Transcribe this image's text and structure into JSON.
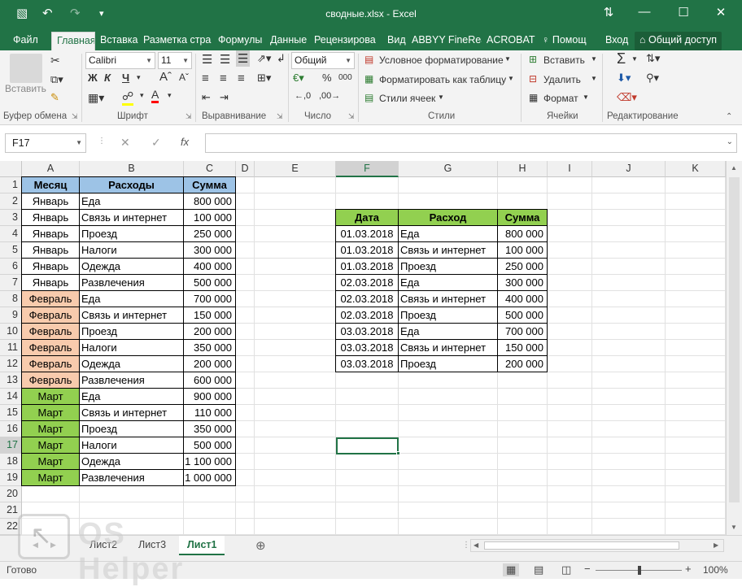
{
  "window": {
    "title": "сводные.xlsx - Excel",
    "controls": [
      "↑↓",
      "—",
      "☐",
      "✕"
    ]
  },
  "qat": [
    "💾",
    "↶",
    "↷",
    "▾"
  ],
  "tabs": [
    "Файл",
    "Главная",
    "Вставка",
    "Разметка стра",
    "Формулы",
    "Данные",
    "Рецензирова",
    "Вид",
    "ABBYY FineRea",
    "ACROBAT",
    "♀ Помощ",
    "Вход",
    "⌂ Общий доступ"
  ],
  "ribbon": {
    "clipboard": {
      "paste": "Вставить",
      "label": "Буфер обмена"
    },
    "font": {
      "name": "Calibri",
      "size": "11",
      "label": "Шрифт",
      "bold": "Ж",
      "italic": "К",
      "underline": "Ч"
    },
    "align": {
      "label": "Выравнивание"
    },
    "number": {
      "format": "Общий",
      "label": "Число",
      "percent": "%",
      "thousands": "000"
    },
    "styles": {
      "conditional": "Условное форматирование",
      "astable": "Форматировать как таблицу",
      "cellstyles": "Стили ячеек",
      "label": "Стили"
    },
    "cells": {
      "insert": "Вставить",
      "delete": "Удалить",
      "format": "Формат",
      "label": "Ячейки"
    },
    "editing": {
      "label": "Редактирование",
      "sum": "Σ"
    }
  },
  "formula": {
    "namebox": "F17",
    "fx": "fx",
    "cancel": "✕",
    "enter": "✓",
    "content": ""
  },
  "columns": [
    "A",
    "B",
    "C",
    "D",
    "E",
    "F",
    "G",
    "H",
    "I",
    "J",
    "K"
  ],
  "rows": [
    "1",
    "2",
    "3",
    "4",
    "5",
    "6",
    "7",
    "8",
    "9",
    "10",
    "11",
    "12",
    "13",
    "14",
    "15",
    "16",
    "17",
    "18",
    "19",
    "20",
    "21",
    "22"
  ],
  "table1": {
    "headers": [
      "Месяц",
      "Расходы",
      "Сумма"
    ],
    "rows": [
      [
        "Январь",
        "Еда",
        "800 000"
      ],
      [
        "Январь",
        "Связь и интернет",
        "100 000"
      ],
      [
        "Январь",
        "Проезд",
        "250 000"
      ],
      [
        "Январь",
        "Налоги",
        "300 000"
      ],
      [
        "Январь",
        "Одежда",
        "400 000"
      ],
      [
        "Январь",
        "Развлечения",
        "500 000"
      ],
      [
        "Февраль",
        "Еда",
        "700 000"
      ],
      [
        "Февраль",
        "Связь и интернет",
        "150 000"
      ],
      [
        "Февраль",
        "Проезд",
        "200 000"
      ],
      [
        "Февраль",
        "Налоги",
        "350 000"
      ],
      [
        "Февраль",
        "Одежда",
        "200 000"
      ],
      [
        "Февраль",
        "Развлечения",
        "600 000"
      ],
      [
        "Март",
        "Еда",
        "900 000"
      ],
      [
        "Март",
        "Связь и интернет",
        "110 000"
      ],
      [
        "Март",
        "Проезд",
        "350 000"
      ],
      [
        "Март",
        "Налоги",
        "500 000"
      ],
      [
        "Март",
        "Одежда",
        "1 100 000"
      ],
      [
        "Март",
        "Развлечения",
        "1 000 000"
      ]
    ]
  },
  "table2": {
    "headers": [
      "Дата",
      "Расход",
      "Сумма"
    ],
    "rows": [
      [
        "01.03.2018",
        "Еда",
        "800 000"
      ],
      [
        "01.03.2018",
        "Связь и интернет",
        "100 000"
      ],
      [
        "01.03.2018",
        "Проезд",
        "250 000"
      ],
      [
        "02.03.2018",
        "Еда",
        "300 000"
      ],
      [
        "02.03.2018",
        "Связь и интернет",
        "400 000"
      ],
      [
        "02.03.2018",
        "Проезд",
        "500 000"
      ],
      [
        "03.03.2018",
        "Еда",
        "700 000"
      ],
      [
        "03.03.2018",
        "Связь и интернет",
        "150 000"
      ],
      [
        "03.03.2018",
        "Проезд",
        "200 000"
      ]
    ]
  },
  "colors": {
    "header_blue": "#9dc3e6",
    "feb": "#f8cbad",
    "mar": "#92d050",
    "t2_header": "#92d050",
    "accent": "#217346"
  },
  "sheets": [
    "Лист2",
    "Лист3",
    "Лист1"
  ],
  "status": {
    "ready": "Готово",
    "zoom": "100%"
  },
  "watermark": "OS Helper"
}
